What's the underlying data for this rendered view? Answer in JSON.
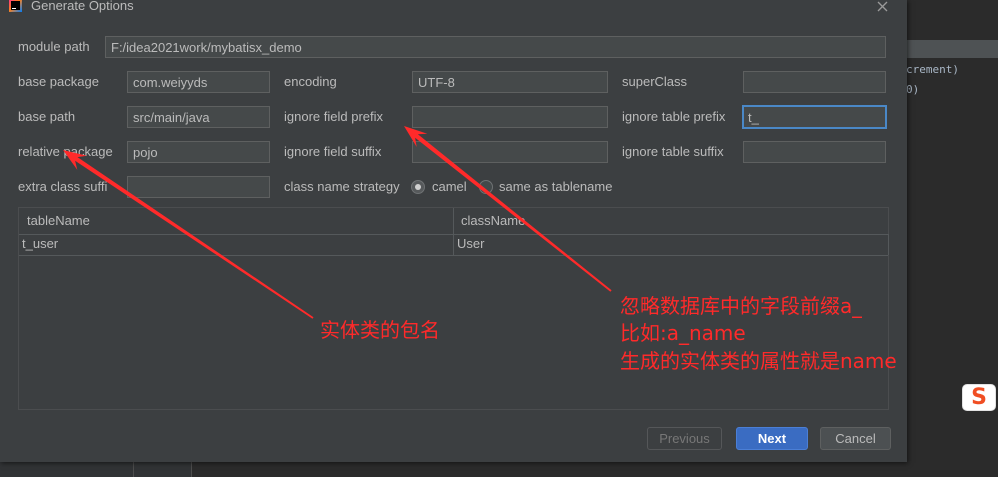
{
  "window": {
    "title": "Generate Options",
    "app_icon": "intellij-idea-icon",
    "close_icon": "close-icon"
  },
  "form": {
    "module_path": {
      "label": "module path",
      "value": "F:/idea2021work/mybatisx_demo"
    },
    "base_package": {
      "label": "base package",
      "value": "com.weiyyds"
    },
    "encoding": {
      "label": "encoding",
      "value": "UTF-8"
    },
    "super_class": {
      "label": "superClass",
      "value": ""
    },
    "base_path": {
      "label": "base path",
      "value": "src/main/java"
    },
    "ignore_field_prefix": {
      "label": "ignore field prefix",
      "value": ""
    },
    "ignore_table_prefix": {
      "label": "ignore table prefix",
      "value": "t_",
      "focused": true
    },
    "relative_package": {
      "label": "relative package",
      "value": "pojo"
    },
    "ignore_field_suffix": {
      "label": "ignore field suffix",
      "value": ""
    },
    "ignore_table_suffix": {
      "label": "ignore table suffix",
      "value": ""
    },
    "extra_class_suffix": {
      "label": "extra class suffi",
      "value": ""
    },
    "class_name_strategy": {
      "label": "class name strategy",
      "options": [
        {
          "label": "camel",
          "selected": true
        },
        {
          "label": "same as tablename",
          "selected": false
        }
      ]
    }
  },
  "table": {
    "columns": [
      "tableName",
      "className"
    ],
    "rows": [
      [
        "t_user",
        "User"
      ]
    ]
  },
  "buttons": {
    "previous": "Previous",
    "previous_enabled": false,
    "next": "Next",
    "cancel": "Cancel"
  },
  "annotations": {
    "color": "#ff2a2a",
    "relative_package_note": "实体类的包名",
    "ignore_field_prefix_note": [
      "忽略数据库中的字段前缀a_",
      "比如:a_name",
      "生成的实体类的属性就是name"
    ]
  },
  "background_editor": {
    "lines": [
      "crement)",
      "0)"
    ]
  },
  "system_tray": {
    "ime_icon": "sogou-ime-icon",
    "ime_logo_text": "S"
  },
  "colors": {
    "dialog_bg": "#3c3f41",
    "editor_bg": "#2b2b2b",
    "accent": "#3a6cc2",
    "focus_border": "#4a88c7"
  }
}
